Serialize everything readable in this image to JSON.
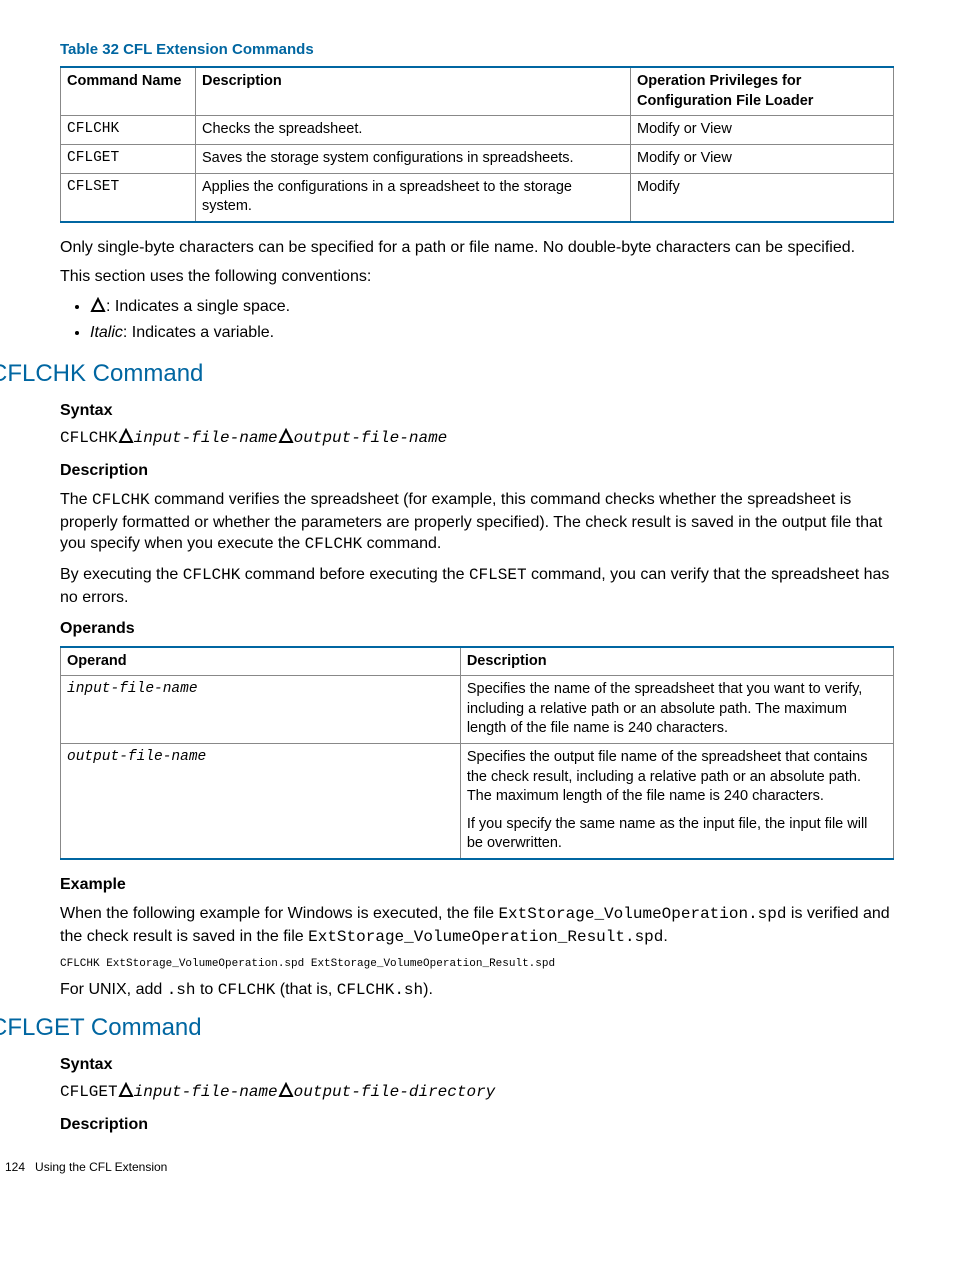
{
  "table32": {
    "title": "Table 32 CFL Extension Commands",
    "headers": [
      "Command Name",
      "Description",
      "Operation Privileges for Configuration File Loader"
    ],
    "rows": [
      [
        "CFLCHK",
        "Checks the spreadsheet.",
        "Modify or View"
      ],
      [
        "CFLGET",
        "Saves the storage system configurations in spreadsheets.",
        "Modify or View"
      ],
      [
        "CFLSET",
        "Applies the configurations in a spreadsheet to the storage system.",
        "Modify"
      ]
    ]
  },
  "p1": "Only single-byte characters can be specified for a path or file name. No double-byte characters can be specified.",
  "p2": "This section uses the following conventions:",
  "conv": {
    "delta_after": ": Indicates a single space.",
    "italic_label": "Italic",
    "italic_after": ": Indicates a variable."
  },
  "cflchk": {
    "heading": "CFLCHK Command",
    "syntax_h": "Syntax",
    "syntax_cmd": "CFLCHK",
    "syntax_in": "input-file-name",
    "syntax_out": "output-file-name",
    "desc_h": "Description",
    "desc_p1a": "The ",
    "desc_p1b": "CFLCHK",
    "desc_p1c": " command verifies the spreadsheet (for example, this command checks whether the spreadsheet is properly formatted or whether the parameters are properly specified). The check result is saved in the output file that you specify when you execute the ",
    "desc_p1d": "CFLCHK",
    "desc_p1e": " command.",
    "desc_p2a": "By executing the ",
    "desc_p2b": "CFLCHK",
    "desc_p2c": " command before executing the ",
    "desc_p2d": "CFLSET",
    "desc_p2e": " command, you can verify that the spreadsheet has no errors.",
    "ops_h": "Operands",
    "ops_headers": [
      "Operand",
      "Description"
    ],
    "ops_rows": [
      {
        "op": "input-file-name",
        "desc": [
          "Specifies the name of the spreadsheet that you want to verify, including a relative path or an absolute path. The maximum length of the file name is 240 characters."
        ]
      },
      {
        "op": "output-file-name",
        "desc": [
          "Specifies the output file name of the spreadsheet that contains the check result, including a relative path or an absolute path. The maximum length of the file name is 240 characters.",
          "If you specify the same name as the input file, the input file will be overwritten."
        ]
      }
    ],
    "ex_h": "Example",
    "ex_p1a": "When the following example for Windows is executed, the file ",
    "ex_p1b": "ExtStorage_VolumeOperation.spd",
    "ex_p1c": " is verified and the check result is saved in the file ",
    "ex_p1d": "ExtStorage_VolumeOperation_Result.spd",
    "ex_p1e": ".",
    "ex_code": "CFLCHK ExtStorage_VolumeOperation.spd ExtStorage_VolumeOperation_Result.spd",
    "ex_p2a": "For UNIX, add ",
    "ex_p2b": ".sh",
    "ex_p2c": " to ",
    "ex_p2d": "CFLCHK",
    "ex_p2e": " (that is, ",
    "ex_p2f": "CFLCHK.sh",
    "ex_p2g": ")."
  },
  "cflget": {
    "heading": "CFLGET Command",
    "syntax_h": "Syntax",
    "syntax_cmd": "CFLGET",
    "syntax_in": "input-file-name",
    "syntax_out": "output-file-directory",
    "desc_h": "Description"
  },
  "footer": {
    "page": "124",
    "text": "Using the CFL Extension"
  }
}
